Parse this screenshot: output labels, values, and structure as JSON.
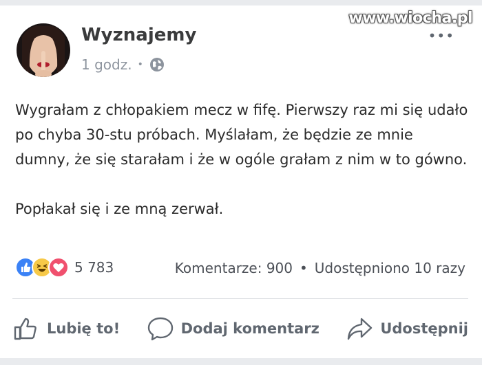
{
  "watermark": "www.wiocha.pl",
  "post": {
    "page_name": "Wyznajemy",
    "time": "1 godz.",
    "meta_separator": "•",
    "privacy_icon": "globe-icon",
    "text_paragraph_1": "Wygrałam z chłopakiem mecz w fifę. Pierwszy raz mi się udało po chyba 30-stu próbach. Myślałam, że będzie ze mnie dumny, że się starałam i że w ogóle grałam z nim w to gówno.",
    "text_paragraph_2": "Popłakał się i ze mną zerwał."
  },
  "reactions": {
    "icons": [
      "like-icon",
      "haha-icon",
      "love-icon"
    ],
    "count": "5 783"
  },
  "stats": {
    "comments": "Komentarze: 900",
    "separator": "•",
    "shares": "Udostępniono 10 razy"
  },
  "actions": {
    "like_label": "Lubię to!",
    "comment_label": "Dodaj komentarz",
    "share_label": "Udostępnij"
  },
  "colors": {
    "like_blue": "#3b82f6",
    "haha_yellow": "#f7c948",
    "love_red": "#f0506e",
    "muted_gray": "#606770"
  }
}
